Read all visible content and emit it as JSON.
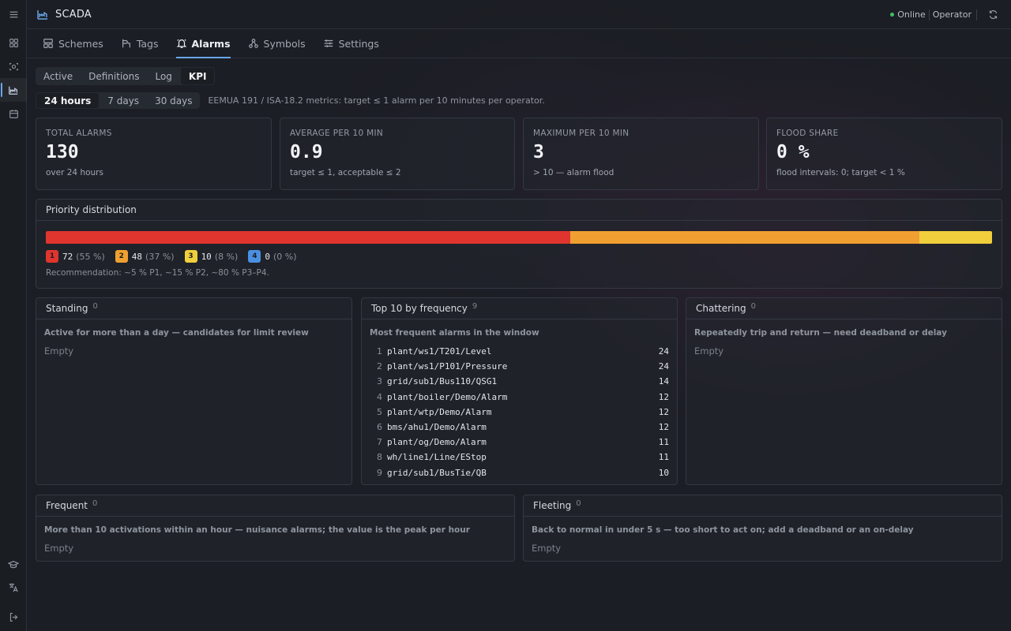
{
  "app": {
    "title": "SCADA"
  },
  "status": {
    "connection": "Online",
    "user": "Operator"
  },
  "nav": {
    "tabs": [
      {
        "label": "Schemes",
        "icon": "schemes-icon"
      },
      {
        "label": "Tags",
        "icon": "tags-icon"
      },
      {
        "label": "Alarms",
        "icon": "bell-icon",
        "active": true
      },
      {
        "label": "Symbols",
        "icon": "symbols-icon"
      },
      {
        "label": "Settings",
        "icon": "sliders-icon"
      }
    ]
  },
  "subtabs": [
    "Active",
    "Definitions",
    "Log",
    "KPI"
  ],
  "subtab_active": "KPI",
  "ranges": [
    "24 hours",
    "7 days",
    "30 days"
  ],
  "range_active": "24 hours",
  "range_note": "EEMUA 191 / ISA-18.2 metrics: target ≤ 1 alarm per 10 minutes per operator.",
  "kpis": [
    {
      "label": "TOTAL ALARMS",
      "value": "130",
      "sub": "over 24 hours"
    },
    {
      "label": "AVERAGE PER 10 MIN",
      "value": "0.9",
      "sub": "target ≤ 1, acceptable ≤ 2"
    },
    {
      "label": "MAXIMUM PER 10 MIN",
      "value": "3",
      "sub": "> 10 — alarm flood"
    },
    {
      "label": "FLOOD SHARE",
      "value": "0 %",
      "sub": "flood intervals: 0; target < 1 %"
    }
  ],
  "priority": {
    "title": "Priority distribution",
    "items": [
      {
        "badge": "1",
        "count": "72",
        "pct": "(55 %)",
        "share": 0.554,
        "color": "#e0352f"
      },
      {
        "badge": "2",
        "count": "48",
        "pct": "(37 %)",
        "share": 0.369,
        "color": "#f0a030"
      },
      {
        "badge": "3",
        "count": "10",
        "pct": "(8 %)",
        "share": 0.077,
        "color": "#f0cf3c"
      },
      {
        "badge": "4",
        "count": "0",
        "pct": "(0 %)",
        "share": 0,
        "color": "#4a90e2"
      }
    ],
    "recommendation": "Recommendation: ~5 % P1, ~15 % P2, ~80 % P3–P4."
  },
  "panels": {
    "standing": {
      "title": "Standing",
      "count": "0",
      "desc": "Active for more than a day — candidates for limit review",
      "empty": "Empty"
    },
    "top10": {
      "title": "Top 10 by frequency",
      "count": "9",
      "desc": "Most frequent alarms in the window",
      "rows": [
        {
          "idx": "1",
          "name": "plant/ws1/T201/Level",
          "n": "24"
        },
        {
          "idx": "2",
          "name": "plant/ws1/P101/Pressure",
          "n": "24"
        },
        {
          "idx": "3",
          "name": "grid/sub1/Bus110/QSG1",
          "n": "14"
        },
        {
          "idx": "4",
          "name": "plant/boiler/Demo/Alarm",
          "n": "12"
        },
        {
          "idx": "5",
          "name": "plant/wtp/Demo/Alarm",
          "n": "12"
        },
        {
          "idx": "6",
          "name": "bms/ahu1/Demo/Alarm",
          "n": "12"
        },
        {
          "idx": "7",
          "name": "plant/og/Demo/Alarm",
          "n": "11"
        },
        {
          "idx": "8",
          "name": "wh/line1/Line/EStop",
          "n": "11"
        },
        {
          "idx": "9",
          "name": "grid/sub1/BusTie/QB",
          "n": "10"
        }
      ]
    },
    "chattering": {
      "title": "Chattering",
      "count": "0",
      "desc": "Repeatedly trip and return — need deadband or delay",
      "empty": "Empty"
    },
    "frequent": {
      "title": "Frequent",
      "count": "0",
      "desc": "More than 10 activations within an hour — nuisance alarms; the value is the peak per hour",
      "empty": "Empty"
    },
    "fleeting": {
      "title": "Fleeting",
      "count": "0",
      "desc": "Back to normal in under 5 s — too short to act on; add a deadband or an on-delay",
      "empty": "Empty"
    }
  }
}
